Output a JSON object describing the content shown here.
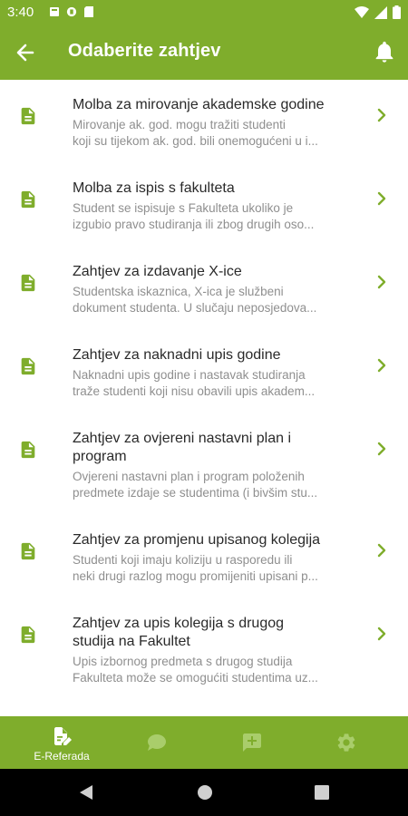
{
  "status_bar": {
    "time": "3:40"
  },
  "app_bar": {
    "title": "Odaberite zahtjev"
  },
  "colors": {
    "accent": "#7fad2c",
    "title": "#2a2a2a",
    "subtitle": "#8f8f8f"
  },
  "requests": [
    {
      "title": "Molba za mirovanje akademske godine",
      "desc_line1": "Mirovanje ak. god. mogu tražiti studenti",
      "desc_line2": "koji su tijekom ak. god. bili onemogućeni u i..."
    },
    {
      "title": "Molba za ispis s fakulteta",
      "desc_line1": "Student se ispisuje s Fakulteta ukoliko je",
      "desc_line2": "izgubio pravo studiranja ili zbog drugih oso..."
    },
    {
      "title": "Zahtjev za izdavanje X-ice",
      "desc_line1": "Studentska iskaznica, X-ica je službeni",
      "desc_line2": "dokument studenta. U slučaju neposjedova..."
    },
    {
      "title": "Zahtjev za naknadni upis godine",
      "desc_line1": "Naknadni upis godine i nastavak studiranja",
      "desc_line2": "traže studenti koji nisu obavili upis akadem..."
    },
    {
      "title_line1": "Zahtjev za ovjereni nastavni plan i",
      "title_line2": "program",
      "desc_line1": "Ovjereni nastavni plan i program položenih",
      "desc_line2": "predmete izdaje se studentima (i bivšim stu..."
    },
    {
      "title": "Zahtjev za promjenu upisanog kolegija",
      "desc_line1": "Studenti koji imaju koliziju u rasporedu ili",
      "desc_line2": "neki drugi razlog mogu promijeniti upisani p..."
    },
    {
      "title_line1": "Zahtjev za upis kolegija s drugog",
      "title_line2": "studija na Fakultet",
      "desc_line1": "Upis izbornog predmeta s drugog studija",
      "desc_line2": "Fakulteta može se omogućiti studentima uz..."
    }
  ],
  "bottom_nav": {
    "items": [
      {
        "label": "E-Referada",
        "icon": "document-edit-icon",
        "active": true
      },
      {
        "icon": "chat-bubble-icon"
      },
      {
        "icon": "add-comment-icon"
      },
      {
        "icon": "gear-icon"
      }
    ]
  }
}
